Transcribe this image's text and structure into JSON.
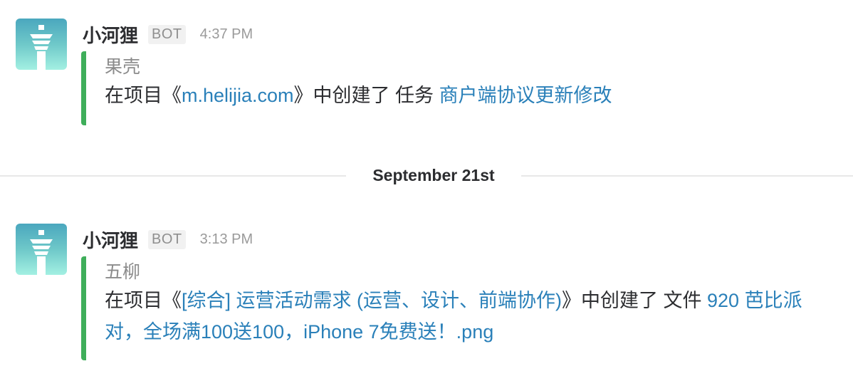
{
  "messages": [
    {
      "sender": "小河狸",
      "badge": "BOT",
      "time": "4:37 PM",
      "author": "果壳",
      "text_prefix": "在项目《",
      "project_link": "m.helijia.com",
      "text_middle": "》中创建了 任务 ",
      "item_link": "商户端协议更新修改",
      "accent_color": "#3fae5a"
    },
    {
      "sender": "小河狸",
      "badge": "BOT",
      "time": "3:13 PM",
      "author": "五柳",
      "text_prefix": "在项目《",
      "project_link": "[综合] 运营活动需求 (运营、设计、前端协作)",
      "text_middle": "》中创建了 文件 ",
      "item_link": "920 芭比派对，全场满100送100，iPhone 7免费送！.png",
      "accent_color": "#3fae5a"
    }
  ],
  "date_divider": "September 21st",
  "avatar_icon": "lighthouse-icon",
  "colors": {
    "link": "#2a80b9",
    "accent": "#3fae5a"
  }
}
